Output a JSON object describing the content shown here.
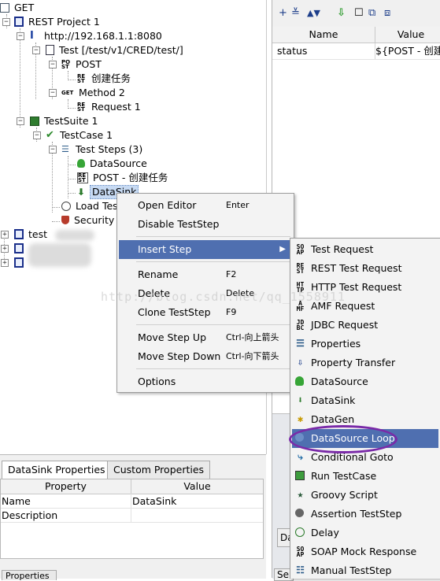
{
  "tree": {
    "root_label": "GET",
    "project": "REST Project 1",
    "endpoint": "http://192.168.1.1:8080",
    "resource": "Test [/test/v1/CRED/test/]",
    "method_post": "POST",
    "request_create": "创建任务",
    "method2": "Method 2",
    "request1": "Request 1",
    "testsuite": "TestSuite 1",
    "testcase": "TestCase 1",
    "teststeps": "Test Steps (3)",
    "step_datasource": "DataSource",
    "step_post": "POST - 创建任务",
    "step_datasink": "DataSink",
    "load_tests": "Load Tes",
    "security": "Security",
    "other_project": "test"
  },
  "properties_panel": {
    "col_name": "Name",
    "col_value": "Value",
    "row_name": "status",
    "row_value": "${POST - 创建"
  },
  "bottom": {
    "tab1": "DataSink Properties",
    "tab2": "Custom Properties",
    "col_property": "Property",
    "col_value": "Value",
    "rows": [
      {
        "property": "Name",
        "value": "DataSink"
      },
      {
        "property": "Description",
        "value": ""
      }
    ],
    "tab_partial": "Properties",
    "right_tab_partial": "Da",
    "right_tab_partial2": "Se"
  },
  "context_menu": {
    "items": [
      {
        "label": "Open Editor",
        "key": "Enter"
      },
      {
        "label": "Disable TestStep",
        "key": ""
      },
      {
        "label": "Insert Step",
        "key": ""
      },
      {
        "label": "Rename",
        "key": "F2"
      },
      {
        "label": "Delete",
        "key": "Delete"
      },
      {
        "label": "Clone TestStep",
        "key": "F9"
      },
      {
        "label": "Move Step Up",
        "key": "Ctrl-向上箭头"
      },
      {
        "label": "Move Step Down",
        "key": "Ctrl-向下箭头"
      },
      {
        "label": "Options",
        "key": ""
      }
    ]
  },
  "submenu": {
    "items": [
      {
        "label": "Test Request",
        "icon": "soap-icon"
      },
      {
        "label": "REST Test Request",
        "icon": "rest-icon"
      },
      {
        "label": "HTTP Test Request",
        "icon": "http-icon"
      },
      {
        "label": "AMF Request",
        "icon": "amf-icon"
      },
      {
        "label": "JDBC Request",
        "icon": "jdbc-icon"
      },
      {
        "label": "Properties",
        "icon": "properties-icon"
      },
      {
        "label": "Property Transfer",
        "icon": "transfer-icon"
      },
      {
        "label": "DataSource",
        "icon": "datasource-icon"
      },
      {
        "label": "DataSink",
        "icon": "datasink-icon"
      },
      {
        "label": "DataGen",
        "icon": "datagen-icon"
      },
      {
        "label": "DataSource Loop",
        "icon": "loop-icon"
      },
      {
        "label": "Conditional Goto",
        "icon": "goto-icon"
      },
      {
        "label": "Run TestCase",
        "icon": "run-icon"
      },
      {
        "label": "Groovy Script",
        "icon": "groovy-icon"
      },
      {
        "label": "Assertion TestStep",
        "icon": "assertion-icon"
      },
      {
        "label": "Delay",
        "icon": "delay-icon"
      },
      {
        "label": "SOAP Mock Response",
        "icon": "mock-icon"
      },
      {
        "label": "Manual TestStep",
        "icon": "manual-icon"
      }
    ]
  },
  "watermark": "http://blog.csdn.net/qq_1558911"
}
